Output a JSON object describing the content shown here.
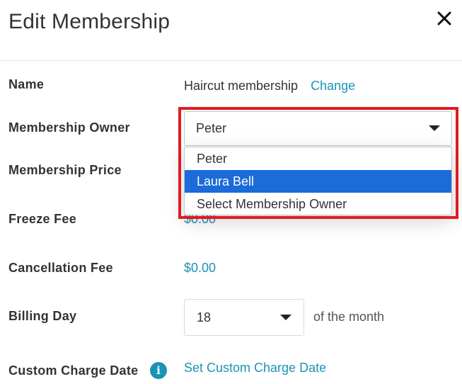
{
  "modal": {
    "title": "Edit Membership",
    "close_icon": "close-icon"
  },
  "fields": {
    "name": {
      "label": "Name",
      "value": "Haircut membership",
      "action": "Change"
    },
    "owner": {
      "label": "Membership Owner",
      "selected": "Peter",
      "options": [
        "Peter",
        "Laura Bell",
        "Select Membership Owner"
      ],
      "highlighted_option": "Laura Bell"
    },
    "price": {
      "label": "Membership Price"
    },
    "freeze_fee": {
      "label": "Freeze Fee",
      "value": "$0.00"
    },
    "cancellation_fee": {
      "label": "Cancellation Fee",
      "value": "$0.00"
    },
    "billing_day": {
      "label": "Billing Day",
      "selected": "18",
      "suffix": "of the month"
    },
    "custom_charge": {
      "label": "Custom Charge Date",
      "info_icon": "info-icon",
      "action": "Set Custom Charge Date"
    }
  },
  "colors": {
    "link": "#1c93b5",
    "selected_option_bg": "#1b6bd8",
    "highlight_border": "#e11b22"
  }
}
